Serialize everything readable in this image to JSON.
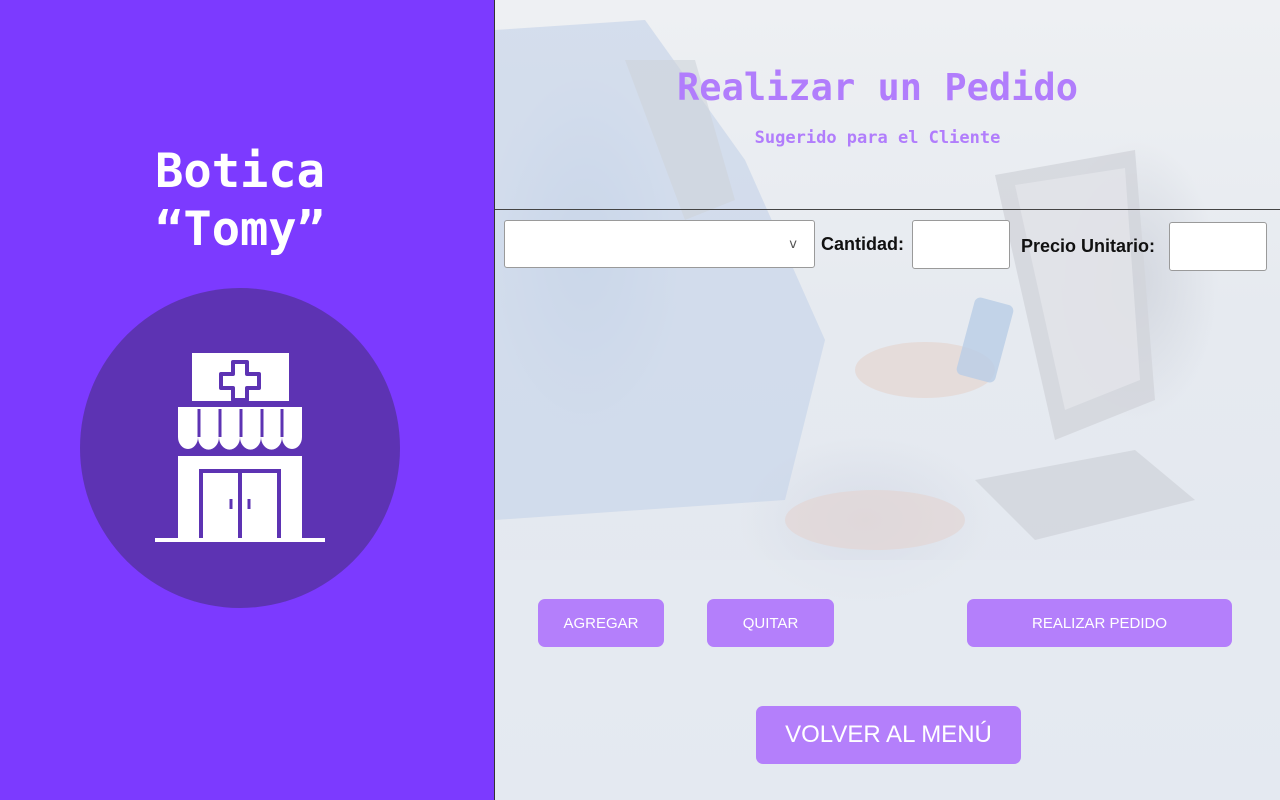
{
  "brand": {
    "name_line1": "Botica",
    "name_line2": "“Tomy”",
    "logo_icon": "pharmacy-store-icon"
  },
  "header": {
    "title": "Realizar un Pedido",
    "subtitle": "Sugerido para el Cliente"
  },
  "form": {
    "product_select": {
      "value": "",
      "chevron": "v"
    },
    "quantity": {
      "label": "Cantidad:",
      "value": ""
    },
    "unit_price": {
      "label": "Precio Unitario:",
      "value": ""
    }
  },
  "actions": {
    "add_label": "AGREGAR",
    "remove_label": "QUITAR",
    "place_order_label": "REALIZAR PEDIDO",
    "back_label": "VOLVER AL MENÚ"
  },
  "colors": {
    "brand_purple": "#7c3aff",
    "logo_circle": "#5d33b3",
    "accent_lavender": "#b17dfc",
    "button": "#b47ffb"
  }
}
